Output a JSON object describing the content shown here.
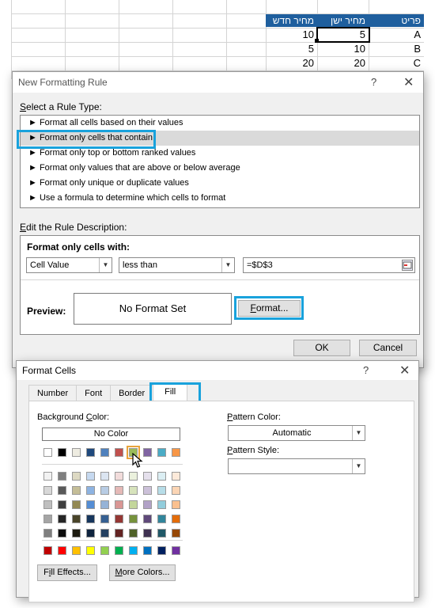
{
  "spreadsheet": {
    "headers": [
      "מחיר חדש",
      "מחיר ישן",
      "פריט"
    ],
    "rows": [
      [
        "10",
        "5",
        "A"
      ],
      [
        "5",
        "10",
        "B"
      ],
      [
        "20",
        "20",
        "C"
      ]
    ],
    "header_color": "#1f5f9e"
  },
  "nfr_dialog": {
    "title": "New Formatting Rule",
    "help": "?",
    "close": "✕",
    "select_rule_type": "elect a Rule Type:",
    "select_rule_type_u": "S",
    "rule_types": [
      "► Format all cells based on their values",
      "► Format only cells that contain",
      "► Format only top or bottom ranked values",
      "► Format only values that are above or below average",
      "► Format only unique or duplicate values",
      "► Use a formula to determine which cells to format"
    ],
    "edit_desc": "dit the Rule Description:",
    "edit_desc_u": "E",
    "format_only_cells_with": "Format only cells with:",
    "condition_field": "Cell Value",
    "condition_operator": "less than",
    "condition_value": "=$D$3",
    "preview_label": "Preview:",
    "preview_text": "No Format Set",
    "format_button_u": "F",
    "format_button_rest": "ormat...",
    "ok": "OK",
    "cancel": "Cancel",
    "highlight_color": "#19a2dc"
  },
  "format_cells": {
    "title": "Format Cells",
    "help": "?",
    "close": "✕",
    "tabs": [
      "Number",
      "Font",
      "Border",
      "Fill"
    ],
    "active_tab": "Fill",
    "background_color_u": "C",
    "background_color_pre": "Background ",
    "background_color_post": "olor:",
    "no_color": "No Color",
    "pattern_color_u": "P",
    "pattern_color_rest": "attern Color:",
    "pattern_color_value": "Automatic",
    "pattern_style_u": "P",
    "pattern_style_rest": "attern Style:",
    "pattern_style_value": "",
    "fill_effects_pre": "F",
    "fill_effects_u": "i",
    "fill_effects_rest": "ll Effects...",
    "more_colors_u": "M",
    "more_colors_rest": "ore Colors...",
    "theme_row1": [
      "#ffffff",
      "#000000",
      "#e7e6e6",
      "#44546a",
      "#4472c4",
      "#ed7d31",
      "#a5a5a5",
      "#70ad47",
      "#5b9bd5",
      "#ffc000"
    ],
    "theme_row1_actual": [
      "#ffffff",
      "#000000",
      "#eeece1",
      "#1f497d",
      "#4f81bd",
      "#c0504d",
      "#9bbb59",
      "#8064a2",
      "#4bacc6",
      "#f79646"
    ],
    "tints": [
      [
        "#f2f2f2",
        "#7f7f7f",
        "#ddd9c3",
        "#c6d9f0",
        "#dbe5f1",
        "#f2dcdb",
        "#ebf1dd",
        "#e5e0ec",
        "#dbeef3",
        "#fdeada"
      ],
      [
        "#d8d8d8",
        "#595959",
        "#c4bd97",
        "#8db3e2",
        "#b8cce4",
        "#e5b9b7",
        "#d7e3bc",
        "#ccc1d9",
        "#b7dde8",
        "#fbd5b5"
      ],
      [
        "#bfbfbf",
        "#3f3f3f",
        "#938953",
        "#548dd4",
        "#95b3d7",
        "#d99694",
        "#c3d69b",
        "#b2a2c7",
        "#92cddc",
        "#fac08f"
      ],
      [
        "#a5a5a5",
        "#262626",
        "#494429",
        "#17365d",
        "#366092",
        "#953734",
        "#76923c",
        "#5f497a",
        "#31859b",
        "#e36c09"
      ],
      [
        "#7f7f7f",
        "#0c0c0c",
        "#1d1b10",
        "#0f243e",
        "#244061",
        "#632423",
        "#4f6128",
        "#3f3151",
        "#205867",
        "#974806"
      ]
    ],
    "standard": [
      "#c00000",
      "#ff0000",
      "#ffc000",
      "#ffff00",
      "#92d050",
      "#00b050",
      "#00b0f0",
      "#0070c0",
      "#002060",
      "#7030a0"
    ],
    "selected_color": "#9bbb59"
  }
}
